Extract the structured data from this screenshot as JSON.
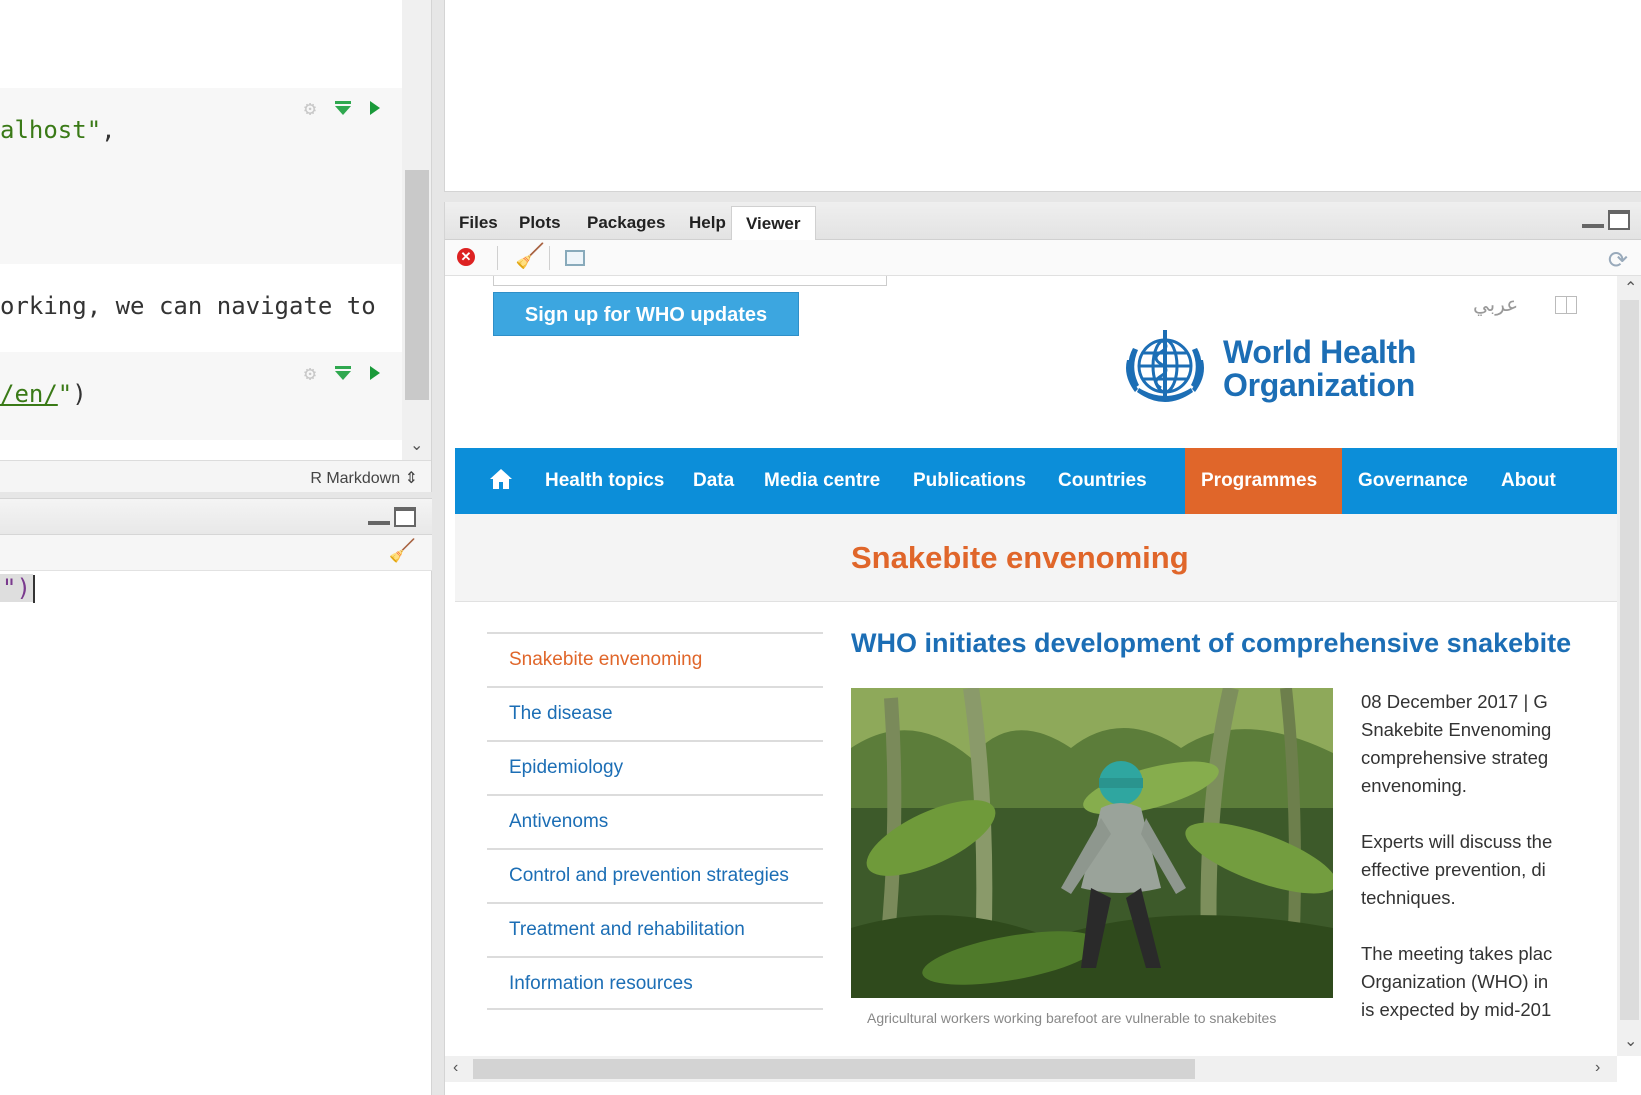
{
  "editor": {
    "lines": [
      {
        "pre": "",
        "str": "alhost\"",
        "post": ","
      },
      {
        "text": "orking, we can navigate to"
      },
      {
        "pre": "",
        "under": "/en/",
        "str_end": "\"",
        "post": ")"
      }
    ],
    "mode": "R Markdown"
  },
  "console": {
    "input_selected": "\")",
    "input_rest": ""
  },
  "viewer": {
    "tabs": [
      "Files",
      "Plots",
      "Packages",
      "Help",
      "Viewer"
    ],
    "active_tab": "Viewer"
  },
  "web": {
    "signup_label": "Sign up for WHO updates",
    "lang_arabic": "عربي",
    "logo_line1": "World Health",
    "logo_line2": "Organization",
    "nav": [
      {
        "label": "Health topics"
      },
      {
        "label": "Data"
      },
      {
        "label": "Media centre"
      },
      {
        "label": "Publications"
      },
      {
        "label": "Countries"
      },
      {
        "label": "Programmes",
        "active": true
      },
      {
        "label": "Governance"
      },
      {
        "label": "About WHO"
      }
    ],
    "section_title": "Snakebite envenoming",
    "side_menu": [
      "Snakebite envenoming",
      "The disease",
      "Epidemiology",
      "Antivenoms",
      "Control and prevention strategies",
      "Treatment and rehabilitation",
      "Information resources"
    ],
    "article_title": "WHO initiates development of comprehensive snakebite",
    "caption": "Agricultural workers working barefoot are vulnerable to snakebites",
    "paragraphs": [
      [
        "08 December 2017 | G",
        "Snakebite Envenoming",
        "comprehensive strateg",
        "envenoming."
      ],
      [
        "Experts will discuss the",
        "effective prevention, di",
        "techniques."
      ],
      [
        "The meeting takes plac",
        "Organization (WHO) in",
        "is expected by mid-201"
      ]
    ]
  },
  "colors": {
    "who_blue": "#0c8ed9",
    "who_orange": "#e0662a",
    "link_blue": "#1c6eb5",
    "signup_blue": "#3ca6e0"
  }
}
